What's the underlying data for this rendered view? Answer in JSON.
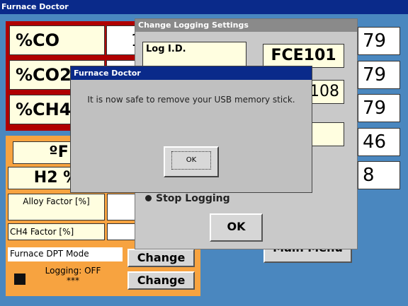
{
  "window": {
    "title": "Furnace Doctor"
  },
  "gases": [
    {
      "label": "%CO",
      "value": "1"
    },
    {
      "label": "%CO2",
      "value": ""
    },
    {
      "label": "%CH4",
      "value": ""
    }
  ],
  "right_values": [
    "79",
    "79",
    "79",
    "46",
    "8"
  ],
  "orange": {
    "temp_label": "ºF",
    "h2_label": "H2 %",
    "alloy_label": "Alloy Factor [%]",
    "ch4_factor_label": "CH4 Factor [%]",
    "mode_label": "Furnace DPT Mode",
    "mode_change": "Change",
    "logging_status": "Logging: OFF",
    "logging_stars": "***",
    "logging_change": "Change"
  },
  "logging_dialog": {
    "title": "Change Logging Settings",
    "log_id_label": "Log I.D.",
    "log_id_value": "FCE101",
    "value2": "108",
    "stop_logging": "Stop Logging",
    "ok": "OK"
  },
  "main_menu": "Main Menu",
  "message_box": {
    "title": "Furnace Doctor",
    "text": "It is now safe to remove your USB memory stick.",
    "ok": "OK"
  }
}
